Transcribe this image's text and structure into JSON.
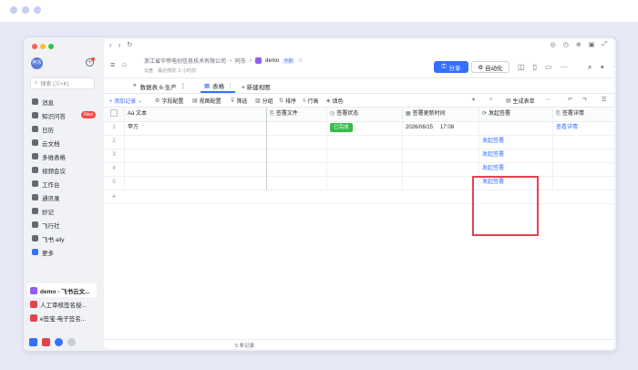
{
  "sidebar": {
    "avatar_text": "阿东",
    "search_placeholder": "搜索 (⌘+K)",
    "items": [
      {
        "label": "消息",
        "icon": "message-icon",
        "color": "#646a73"
      },
      {
        "label": "知识问答",
        "icon": "qa-icon",
        "color": "#646a73",
        "badge": "New"
      },
      {
        "label": "日历",
        "icon": "calendar-icon",
        "color": "#646a73"
      },
      {
        "label": "云文档",
        "icon": "cloud-doc-icon",
        "color": "#646a73"
      },
      {
        "label": "多维表格",
        "icon": "base-icon",
        "color": "#646a73"
      },
      {
        "label": "视频会议",
        "icon": "video-icon",
        "color": "#646a73"
      },
      {
        "label": "工作台",
        "icon": "workspace-icon",
        "color": "#646a73"
      },
      {
        "label": "通讯录",
        "icon": "contacts-icon",
        "color": "#646a73"
      },
      {
        "label": "妙记",
        "icon": "minutes-icon",
        "color": "#646a73"
      },
      {
        "label": "飞行社",
        "icon": "community-icon",
        "color": "#646a73"
      },
      {
        "label": "飞书 aily",
        "icon": "aily-icon",
        "color": "#646a73"
      },
      {
        "label": "更多",
        "icon": "more-grid-icon",
        "color": "#3370ff"
      }
    ],
    "recent": [
      {
        "label": "demo - 飞书云文...",
        "color": "#8f5cf5",
        "active": true
      },
      {
        "label": "人工审核签名授...",
        "color": "#e3434f",
        "active": false
      },
      {
        "label": "e签宝-电子签名...",
        "color": "#e3434f",
        "active": false
      }
    ]
  },
  "header": {
    "company": "浙江省华帝电创信息技术有限公司",
    "sep1": "›",
    "owner": "阿东",
    "sep2": "›",
    "doc_name": "demo",
    "ext_tag": "外部",
    "sub_location": "云盘",
    "sub_edited": "最近修改: 2 小时前",
    "share_label": "分享",
    "automation_label": "自动化"
  },
  "tabs": {
    "collapse_label": "数据表 6-生产",
    "active_tab": "表格",
    "new_view_label": "+ 新建视图"
  },
  "toolbar": {
    "add_record": "+ 添加记录",
    "field_config": "字段配置",
    "view_config": "视图配置",
    "filter": "筛选",
    "group": "分组",
    "sort": "排序",
    "row_height": "行高",
    "fill_color": "填色",
    "generate_form": "生成表单"
  },
  "table": {
    "columns": [
      "Aa 文本",
      "签署文件",
      "签署状态",
      "签署更新时间",
      "发起签署",
      "签署详情"
    ],
    "rows": [
      {
        "num": "1",
        "text": "甲方",
        "file": "",
        "status": "已完成",
        "time": "2026/06/15",
        "time2": "17:08",
        "action": "",
        "detail": "查看详情"
      },
      {
        "num": "2",
        "text": "",
        "file": "",
        "status": "",
        "time": "",
        "time2": "",
        "action": "发起签署",
        "detail": ""
      },
      {
        "num": "3",
        "text": "",
        "file": "",
        "status": "",
        "time": "",
        "time2": "",
        "action": "发起签署",
        "detail": ""
      },
      {
        "num": "4",
        "text": "",
        "file": "",
        "status": "",
        "time": "",
        "time2": "",
        "action": "发起签署",
        "detail": ""
      },
      {
        "num": "5",
        "text": "",
        "file": "",
        "status": "",
        "time": "",
        "time2": "",
        "action": "发起签署",
        "detail": ""
      }
    ],
    "add_row": "+",
    "record_count": "5 条记录"
  },
  "colors": {
    "accent": "#3370ff",
    "done_tag": "#35bd4b",
    "highlight_box": "#e3434f"
  }
}
